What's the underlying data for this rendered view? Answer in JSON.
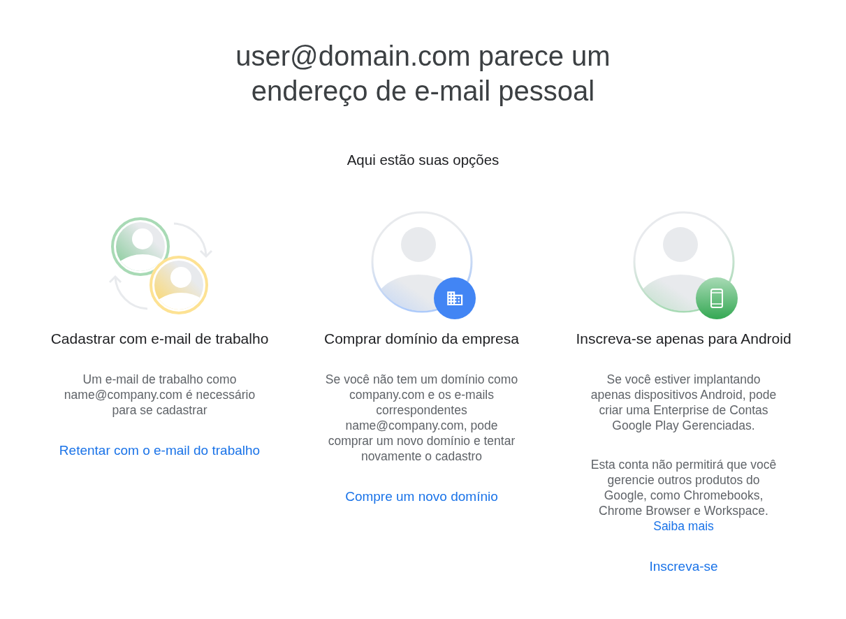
{
  "heading": "user@domain.com parece um endereço de e-mail pessoal",
  "subheading": "Aqui estão suas opções",
  "options": [
    {
      "kind": "work_email",
      "title": "Cadastrar com e-mail de trabalho",
      "paragraphs": [
        {
          "text": "Um e-mail de trabalho como name@company.com é necessário para se cadastrar"
        }
      ],
      "action": "Retentar com o e-mail do trabalho"
    },
    {
      "kind": "buy_domain",
      "title": "Comprar domínio da empresa",
      "paragraphs": [
        {
          "text": "Se você não tem um domínio como company.com e os e-mails correspondentes name@company.com, pode comprar um novo domínio e tentar novamente o cadastro"
        }
      ],
      "action": "Compre um novo domínio"
    },
    {
      "kind": "android",
      "title": "Inscreva-se apenas para Android",
      "paragraphs": [
        {
          "text": "Se você estiver implantando apenas dispositivos Android, pode criar uma Enterprise de Contas Google Play Gerenciadas."
        },
        {
          "text": "Esta conta não permitirá que você gerencie outros produtos do Google, como Chromebooks, Chrome Browser e Workspace.",
          "link": "Saiba mais"
        }
      ],
      "action": "Inscreva-se"
    }
  ]
}
